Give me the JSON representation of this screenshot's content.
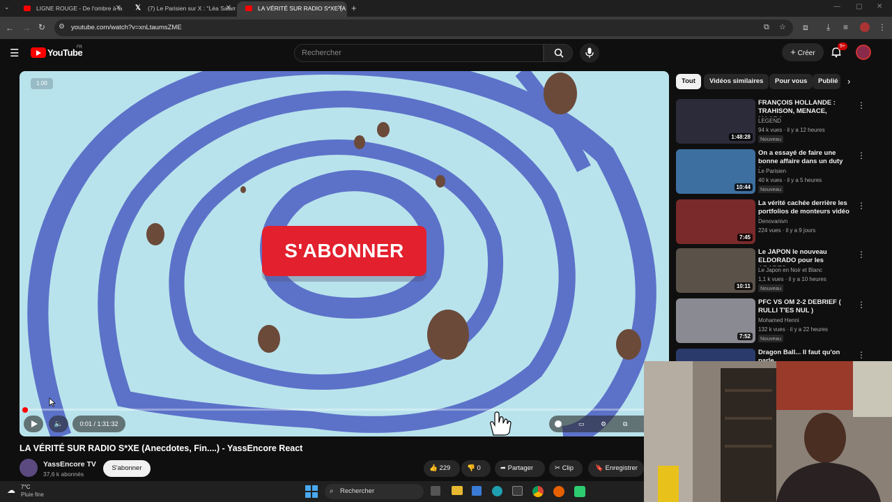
{
  "browser": {
    "tabs": [
      {
        "label": "LIGNE ROUGE - De l'ombre à la",
        "icon": "youtube-icon",
        "active": false
      },
      {
        "label": "(7) Le Parisien sur X : \"Léa Salam",
        "icon": "x-icon",
        "active": false
      },
      {
        "label": "LA VÉRITÉ SUR RADIO S*XE (A",
        "icon": "youtube-icon",
        "active": true
      }
    ],
    "url": "youtube.com/watch?v=xnLtaumsZME"
  },
  "youtube": {
    "logo_text": "YouTube",
    "region": "FR",
    "search_placeholder": "Rechercher",
    "create_label": "Créer",
    "notif_count": "9+"
  },
  "player": {
    "overlay_button": "S'ABONNER",
    "speed_badge": "1.00",
    "time": "0:01 / 1:31:32",
    "progress": 0.0002
  },
  "video": {
    "title": "LA VÉRITÉ SUR RADIO S*XE (Anecdotes, Fin....) - YassEncore React",
    "channel": "YassEncore TV",
    "subscribers": "37,6 k abonnés",
    "subscribe_label": "S'abonner",
    "likes": "229",
    "dislikes": "0",
    "share_label": "Partager",
    "clip_label": "Clip",
    "save_label": "Enregistrer"
  },
  "sidebar": {
    "chips": [
      "Tout",
      "Vidéos similaires",
      "Pour vous",
      "Publié"
    ],
    "recs": [
      {
        "title": "FRANÇOIS HOLLANDE : TRAHISON, MENACE, MACRO...",
        "channel": "LEGEND",
        "meta": "94 k vues · il y a 12 heures",
        "badge": "Nouveau",
        "duration": "1:48:28",
        "thumb_color": "#2b2b3a"
      },
      {
        "title": "On a essayé de faire une bonne affaire dans un duty free",
        "channel": "Le Parisien",
        "meta": "40 k vues · il y a 5 heures",
        "badge": "Nouveau",
        "duration": "10:44",
        "thumb_color": "#3d6fa0"
      },
      {
        "title": "La vérité cachée derrière les portfolios de monteurs vidéo !",
        "channel": "Denovanivn",
        "meta": "224 vues · il y a 9 jours",
        "badge": "",
        "duration": "7:45",
        "thumb_color": "#7a2a2a"
      },
      {
        "title": "Le JAPON le nouveau ELDORADO pour les ARABES e...",
        "channel": "Le Japon en Noir et Blanc",
        "meta": "1,1 k vues · il y a 10 heures",
        "badge": "Nouveau",
        "duration": "10:11",
        "thumb_color": "#5a5148"
      },
      {
        "title": "PFC VS OM 2-2 DEBRIEF ( RULLI T'ES NUL )",
        "channel": "Mohamed Henni",
        "meta": "132 k vues · il y a 22 heures",
        "badge": "Nouveau",
        "duration": "7:52",
        "thumb_color": "#8a8a92"
      },
      {
        "title": "Dragon Ball... Il faut qu'on parle",
        "channel": "",
        "meta": "",
        "badge": "",
        "duration": "",
        "thumb_color": "#2a3a6a"
      }
    ]
  },
  "taskbar": {
    "weather_temp": "7°C",
    "weather_desc": "Pluie fine",
    "search_label": "Rechercher"
  }
}
